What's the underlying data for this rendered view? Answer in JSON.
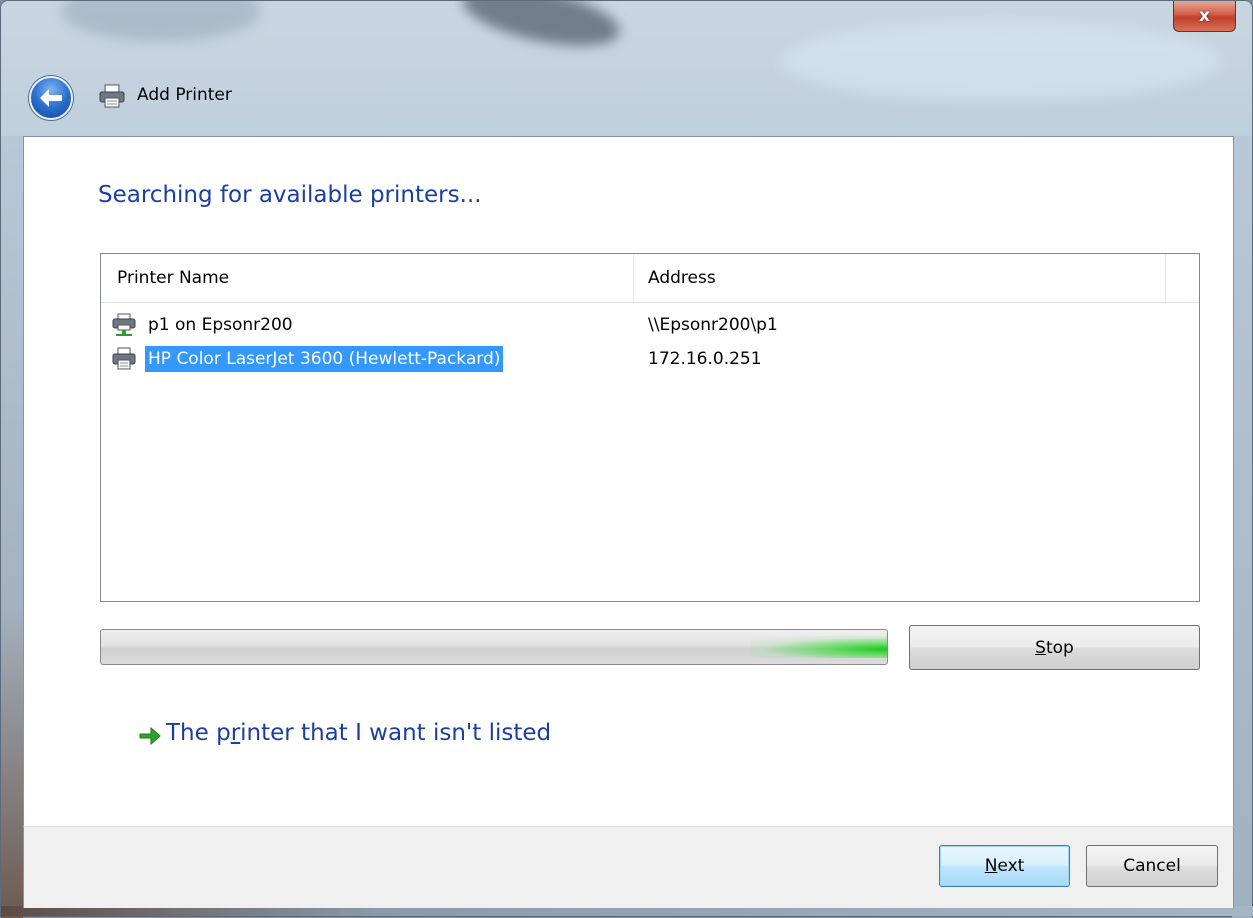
{
  "window": {
    "title": "Add Printer",
    "close_label": "x"
  },
  "wizard": {
    "heading": "Searching for available printers..."
  },
  "printer_list": {
    "columns": [
      "Printer Name",
      "Address"
    ],
    "rows": [
      {
        "name": "p1 on Epsonr200",
        "address": "\\\\Epsonr200\\p1",
        "icon": "network-printer-icon",
        "selected": false
      },
      {
        "name": "HP Color LaserJet 3600 (Hewlett-Packard)",
        "address": "172.16.0.251",
        "icon": "printer-icon",
        "selected": true
      }
    ]
  },
  "progress": {
    "state": "searching (indeterminate)"
  },
  "buttons": {
    "stop_mnemonic": "S",
    "stop_rest": "top",
    "next_mnemonic": "N",
    "next_rest": "ext",
    "cancel": "Cancel"
  },
  "link": {
    "text_before": "The p",
    "text_mnemonic": "r",
    "text_after": "inter that I want isn't listed"
  },
  "colors": {
    "heading": "#1a3fa0",
    "selection": "#3399ff",
    "progress_glow": "#1ec81e",
    "link_arrow": "#2aa52a"
  }
}
